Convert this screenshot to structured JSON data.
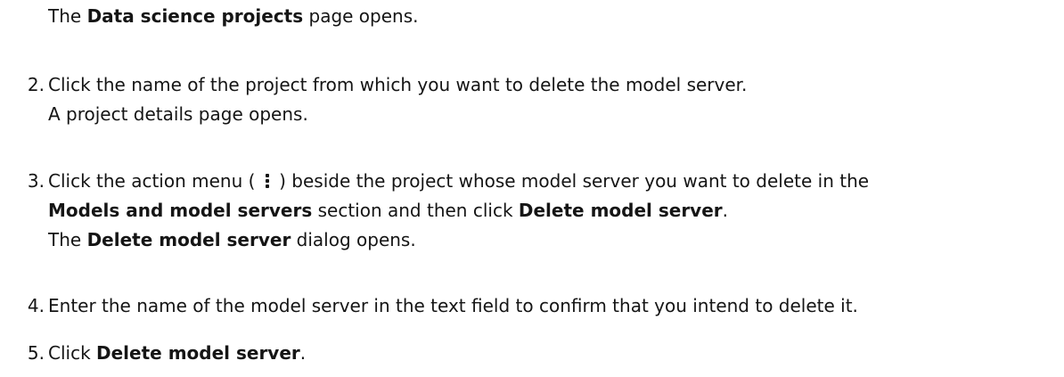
{
  "intro": {
    "pre": "The ",
    "bold": "Data science projects",
    "post": " page opens."
  },
  "steps": [
    {
      "number": "2.",
      "line1": "Click the name of the project from which you want to delete the model server.",
      "line2": "A project details page opens."
    },
    {
      "number": "3.",
      "line1_pre": "Click the action menu ( ",
      "line1_post": " ) beside the project whose model server you want to delete in the",
      "line2_bold1": "Models and model servers",
      "line2_mid": " section and then click ",
      "line2_bold2": "Delete model server",
      "line2_end": ".",
      "line3_pre": "The ",
      "line3_bold": "Delete model server",
      "line3_post": " dialog opens."
    },
    {
      "number": "4.",
      "line1": "Enter the name of the model server in the text field to confirm that you intend to delete it."
    },
    {
      "number": "5.",
      "line1_pre": "Click ",
      "line1_bold": "Delete model server",
      "line1_end": "."
    }
  ],
  "icons": {
    "action_menu": "kebab-icon"
  }
}
